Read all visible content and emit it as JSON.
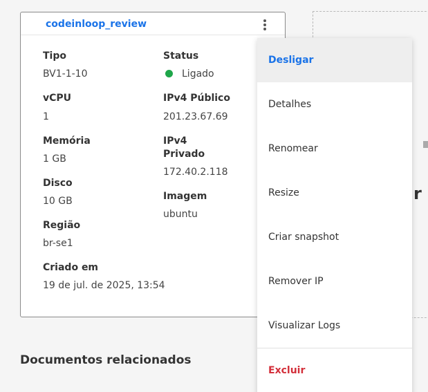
{
  "card": {
    "title": "codeinloop_review",
    "fields": {
      "tipo": {
        "label": "Tipo",
        "value": "BV1-1-10"
      },
      "vcpu": {
        "label": "vCPU",
        "value": "1"
      },
      "memoria": {
        "label": "Memória",
        "value": "1 GB"
      },
      "disco": {
        "label": "Disco",
        "value": "10 GB"
      },
      "regiao": {
        "label": "Região",
        "value": "br-se1"
      },
      "criado": {
        "label": "Criado em",
        "value": "19 de jul. de 2025, 13:54"
      },
      "status": {
        "label": "Status",
        "value": "Ligado",
        "color": "#1fa64a"
      },
      "ipv4_publico": {
        "label": "IPv4 Público",
        "value": "201.23.67.69"
      },
      "ipv4_privado": {
        "label_line1": "IPv4",
        "label_line2": "Privado",
        "value": "172.40.2.118"
      },
      "imagem": {
        "label": "Imagem",
        "value": "ubuntu"
      }
    }
  },
  "menu": {
    "items": [
      {
        "label": "Desligar"
      },
      {
        "label": "Detalhes"
      },
      {
        "label": "Renomear"
      },
      {
        "label": "Resize"
      },
      {
        "label": "Criar snapshot"
      },
      {
        "label": "Remover IP"
      },
      {
        "label": "Visualizar Logs"
      },
      {
        "label": "Excluir"
      }
    ]
  },
  "background": {
    "fragment": "r"
  },
  "sections": {
    "docs_title": "Documentos relacionados"
  },
  "colors": {
    "accent": "#1a73e8",
    "danger": "#d32f3a",
    "status_on": "#1fa64a"
  }
}
